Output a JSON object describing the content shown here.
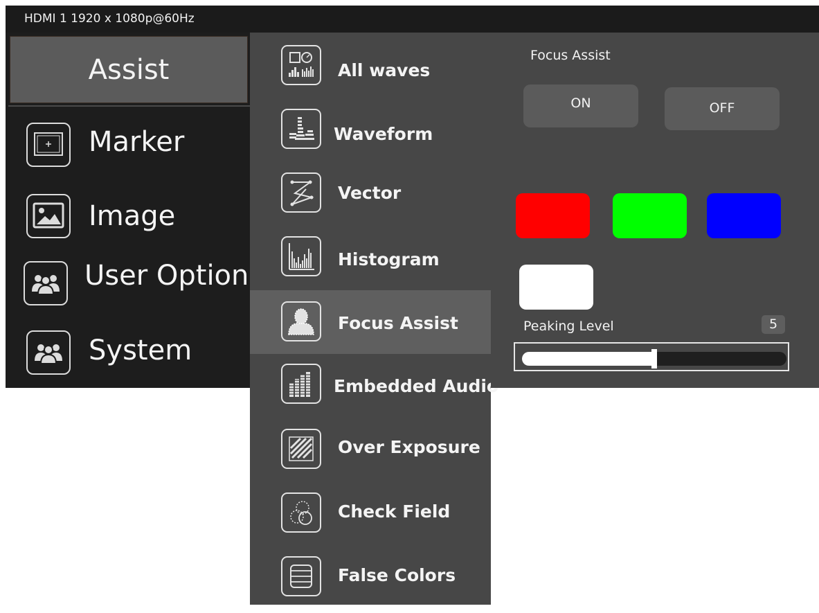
{
  "status_bar": {
    "text": "HDMI 1 1920 x 1080p@60Hz"
  },
  "left_menu": {
    "header": "Assist",
    "items": [
      {
        "label": "Marker",
        "icon": "marker-icon"
      },
      {
        "label": "Image",
        "icon": "image-icon"
      },
      {
        "label": "User Option",
        "icon": "user-option-icon"
      },
      {
        "label": "System",
        "icon": "system-icon"
      }
    ]
  },
  "middle_menu": {
    "selected": "Focus Assist",
    "items": [
      {
        "label": "All waves",
        "icon": "all-waves-icon"
      },
      {
        "label": "Waveform",
        "icon": "waveform-icon"
      },
      {
        "label": "Vector",
        "icon": "vector-icon"
      },
      {
        "label": "Histogram",
        "icon": "histogram-icon"
      },
      {
        "label": "Focus Assist",
        "icon": "focus-assist-icon"
      },
      {
        "label": "Embedded Audio",
        "icon": "embedded-audio-icon"
      },
      {
        "label": "Over Exposure",
        "icon": "over-exposure-icon"
      },
      {
        "label": "Check Field",
        "icon": "check-field-icon"
      },
      {
        "label": "False Colors",
        "icon": "false-colors-icon"
      }
    ]
  },
  "focus_assist_panel": {
    "title": "Focus Assist",
    "on_label": "ON",
    "off_label": "OFF",
    "colors": [
      {
        "name": "red",
        "hex": "#ff0000"
      },
      {
        "name": "green",
        "hex": "#00ff00"
      },
      {
        "name": "blue",
        "hex": "#0000ff"
      },
      {
        "name": "white",
        "hex": "#ffffff"
      }
    ],
    "peaking_level_label": "Peaking Level",
    "peaking_level_value": "5",
    "peaking_level_max": 10
  }
}
